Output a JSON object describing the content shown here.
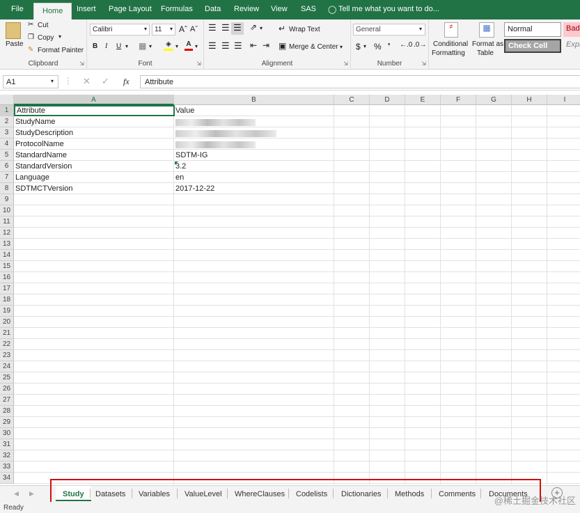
{
  "menu": {
    "file": "File",
    "home": "Home",
    "insert": "Insert",
    "page_layout": "Page Layout",
    "formulas": "Formulas",
    "data": "Data",
    "review": "Review",
    "view": "View",
    "sas": "SAS",
    "tell_me": "Tell me what you want to do..."
  },
  "ribbon": {
    "clipboard": {
      "paste": "Paste",
      "cut": "Cut",
      "copy": "Copy",
      "format_painter": "Format Painter",
      "label": "Clipboard"
    },
    "font": {
      "name": "Calibri",
      "size": "11",
      "label": "Font"
    },
    "alignment": {
      "wrap_text": "Wrap Text",
      "merge_center": "Merge & Center",
      "label": "Alignment"
    },
    "number": {
      "format": "General",
      "label": "Number",
      "pct": "%",
      "currency": "$"
    },
    "styles": {
      "conditional": "Conditional",
      "formatting": "Formatting",
      "format_as": "Format as",
      "table": "Table",
      "normal": "Normal",
      "bad": "Bad",
      "check_cell": "Check Cell",
      "explanatory": "Expl"
    }
  },
  "formula_bar": {
    "name_box": "A1",
    "fx": "fx",
    "value": "Attribute"
  },
  "columns": [
    "A",
    "B",
    "C",
    "D",
    "E",
    "F",
    "G",
    "H",
    "I"
  ],
  "rows": [
    "1",
    "2",
    "3",
    "4",
    "5",
    "6",
    "7",
    "8",
    "9",
    "10",
    "11",
    "12",
    "13",
    "14",
    "15",
    "16",
    "17",
    "18",
    "19",
    "20",
    "21",
    "22",
    "23",
    "24",
    "25",
    "26",
    "27",
    "28",
    "29",
    "30",
    "31",
    "32",
    "33",
    "34"
  ],
  "cells": {
    "a": [
      "Attribute",
      "StudyName",
      "StudyDescription",
      "ProtocolName",
      "StandardName",
      "StandardVersion",
      "Language",
      "SDTMCTVersion"
    ],
    "b": [
      "Value",
      "",
      "",
      "",
      "SDTM-IG",
      "3.2",
      "en",
      "2017-12-22"
    ]
  },
  "sheets": [
    "Study",
    "Datasets",
    "Variables",
    "ValueLevel",
    "WhereClauses",
    "Codelists",
    "Dictionaries",
    "Methods",
    "Comments",
    "Documents"
  ],
  "status": "Ready",
  "watermark": "@稀土掘金技术社区",
  "colors": {
    "brand": "#217346",
    "highlight": "#d01010"
  }
}
